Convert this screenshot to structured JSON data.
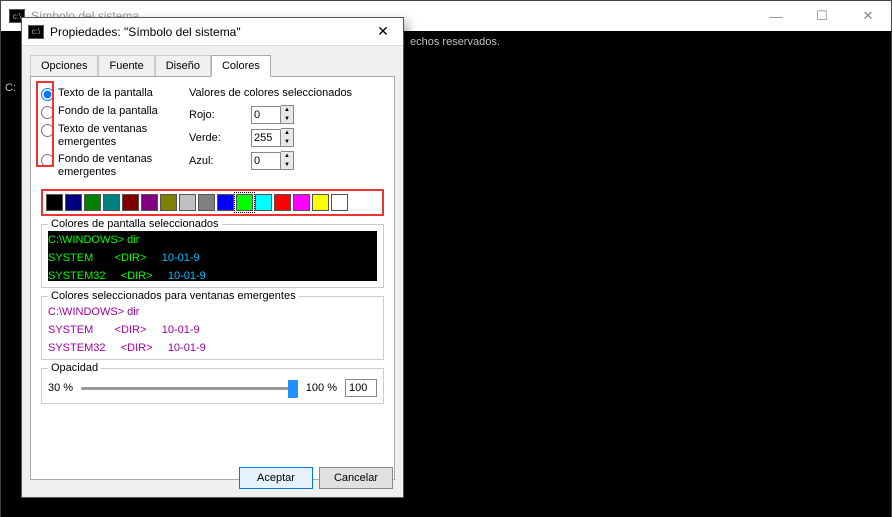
{
  "main_window": {
    "title": "Símbolo del sistema",
    "console_visible_text": "echos reservados.",
    "prompt_fragment": "C:"
  },
  "dialog": {
    "title": "Propiedades: \"Símbolo del sistema\"",
    "tabs": {
      "options": "Opciones",
      "font": "Fuente",
      "layout": "Diseño",
      "colors": "Colores"
    },
    "active_tab": "colors",
    "radios": {
      "screen_text": "Texto de la pantalla",
      "screen_bg": "Fondo de la pantalla",
      "popup_text": "Texto de ventanas emergentes",
      "popup_bg": "Fondo de ventanas emergentes",
      "selected": "screen_text"
    },
    "values": {
      "title": "Valores de colores seleccionados",
      "red_label": "Rojo:",
      "green_label": "Verde:",
      "blue_label": "Azul:",
      "red": "0",
      "green": "255",
      "blue": "0"
    },
    "swatches": [
      "#000000",
      "#000080",
      "#008000",
      "#008080",
      "#800000",
      "#800080",
      "#808000",
      "#c0c0c0",
      "#808080",
      "#0000ff",
      "#00ff00",
      "#00ffff",
      "#ff0000",
      "#ff00ff",
      "#ffff00",
      "#ffffff"
    ],
    "selected_swatch_index": 10,
    "preview_screen": {
      "title": "Colores de pantalla seleccionados",
      "line1a": "C:\\WINDOWS> ",
      "line1b": "dir",
      "line2a": "SYSTEM       ",
      "line2b": "<DIR>     ",
      "line2c": "10-01-9",
      "line3a": "SYSTEM32     ",
      "line3b": "<DIR>     ",
      "line3c": "10-01-9"
    },
    "preview_popup": {
      "title": "Colores seleccionados para ventanas emergentes",
      "line1": "C:\\WINDOWS> dir",
      "line2": "SYSTEM       <DIR>     10-01-9",
      "line3": "SYSTEM32     <DIR>     10-01-9"
    },
    "opacity": {
      "title": "Opacidad",
      "min_label": "30 %",
      "max_label": "100 %",
      "value": "100"
    },
    "buttons": {
      "ok": "Aceptar",
      "cancel": "Cancelar"
    }
  }
}
